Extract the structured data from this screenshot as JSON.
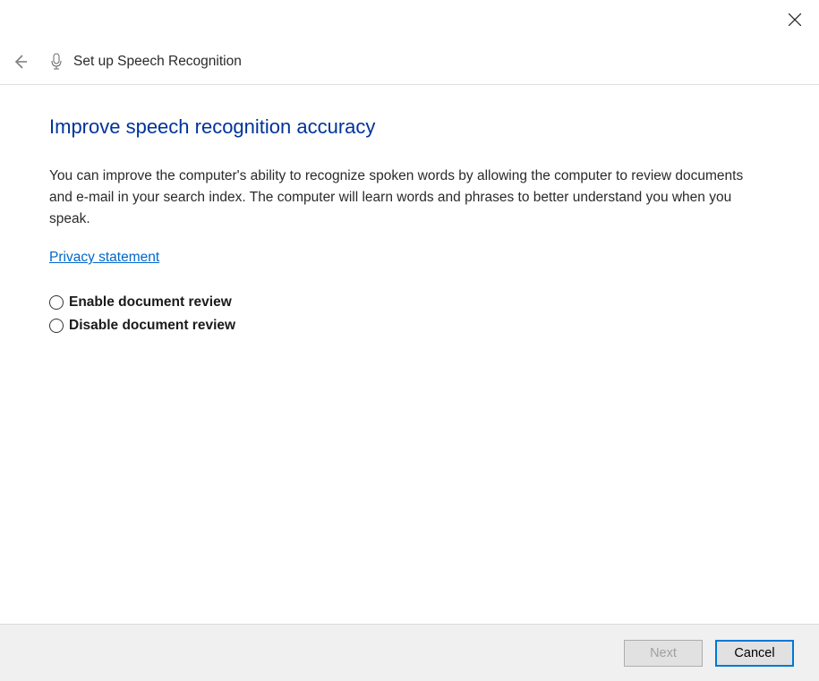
{
  "window": {
    "title": "Set up Speech Recognition"
  },
  "page": {
    "heading": "Improve speech recognition accuracy",
    "description": "You can improve the computer's ability to recognize spoken words by allowing the computer to review documents and e-mail in your search index. The computer will learn words and phrases to better understand you when you speak.",
    "privacy_link": "Privacy statement"
  },
  "options": {
    "enable": "Enable document review",
    "disable": "Disable document review"
  },
  "footer": {
    "next": "Next",
    "cancel": "Cancel"
  }
}
